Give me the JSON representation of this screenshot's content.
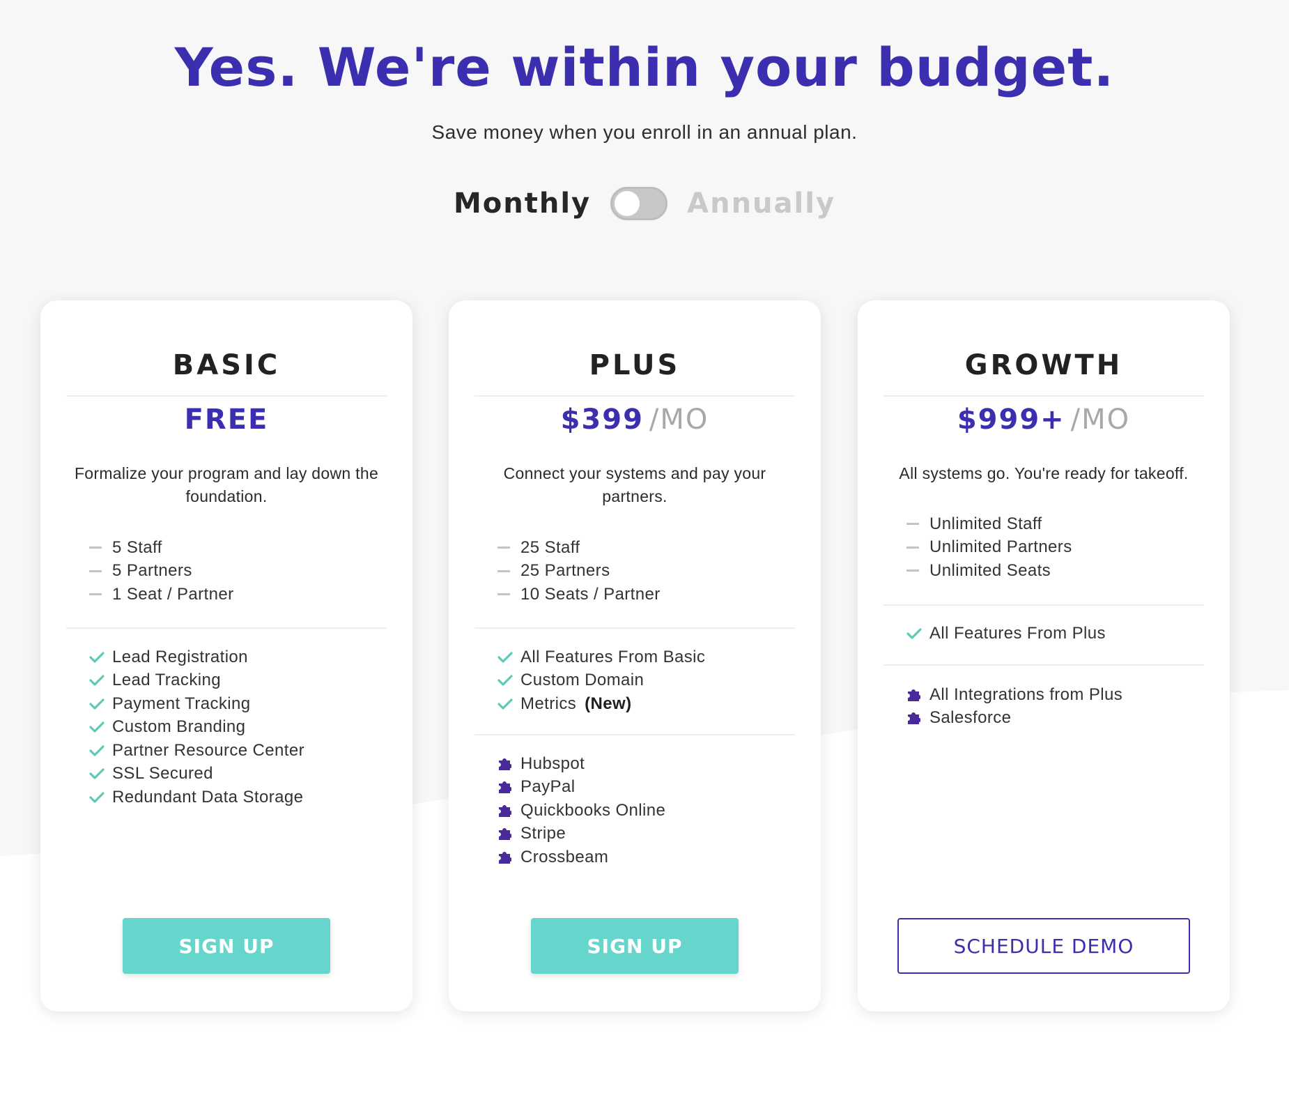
{
  "header": {
    "headline": "Yes. We're within your budget.",
    "subline": "Save money when you enroll in an annual plan."
  },
  "billing": {
    "monthly_label": "Monthly",
    "annually_label": "Annually",
    "selected": "Monthly"
  },
  "colors": {
    "brand_purple": "#3b2fb0",
    "teal": "#66d6cc",
    "check_green": "#5fc9b8",
    "puzzle_purple": "#4a2a9a",
    "page_gray": "#f7f7f7"
  },
  "plans": [
    {
      "name": "BASIC",
      "price": "FREE",
      "unit": "",
      "description": "Formalize your program and lay down the foundation.",
      "limits": [
        "5 Staff",
        "5 Partners",
        "1 Seat / Partner"
      ],
      "features": [
        {
          "label": "Lead Registration",
          "badge": ""
        },
        {
          "label": "Lead Tracking",
          "badge": ""
        },
        {
          "label": "Payment Tracking",
          "badge": ""
        },
        {
          "label": "Custom Branding",
          "badge": ""
        },
        {
          "label": "Partner Resource Center",
          "badge": ""
        },
        {
          "label": "SSL Secured",
          "badge": ""
        },
        {
          "label": "Redundant Data Storage",
          "badge": ""
        }
      ],
      "integrations": [],
      "cta": "SIGN UP"
    },
    {
      "name": "PLUS",
      "price": "$399",
      "unit": "/MO",
      "description": "Connect your systems and pay your partners.",
      "limits": [
        "25 Staff",
        "25 Partners",
        "10 Seats / Partner"
      ],
      "features": [
        {
          "label": "All Features From Basic",
          "badge": ""
        },
        {
          "label": "Custom Domain",
          "badge": ""
        },
        {
          "label": "Metrics",
          "badge": "(New)"
        }
      ],
      "integrations": [
        "Hubspot",
        "PayPal",
        "Quickbooks Online",
        "Stripe",
        "Crossbeam"
      ],
      "cta": "SIGN UP"
    },
    {
      "name": "GROWTH",
      "price": "$999+",
      "unit": "/MO",
      "description": "All systems go. You're ready for takeoff.",
      "limits": [
        "Unlimited Staff",
        "Unlimited Partners",
        "Unlimited Seats"
      ],
      "features": [
        {
          "label": "All Features From Plus",
          "badge": ""
        }
      ],
      "integrations": [
        "All Integrations from Plus",
        "Salesforce"
      ],
      "cta": "SCHEDULE DEMO"
    }
  ]
}
